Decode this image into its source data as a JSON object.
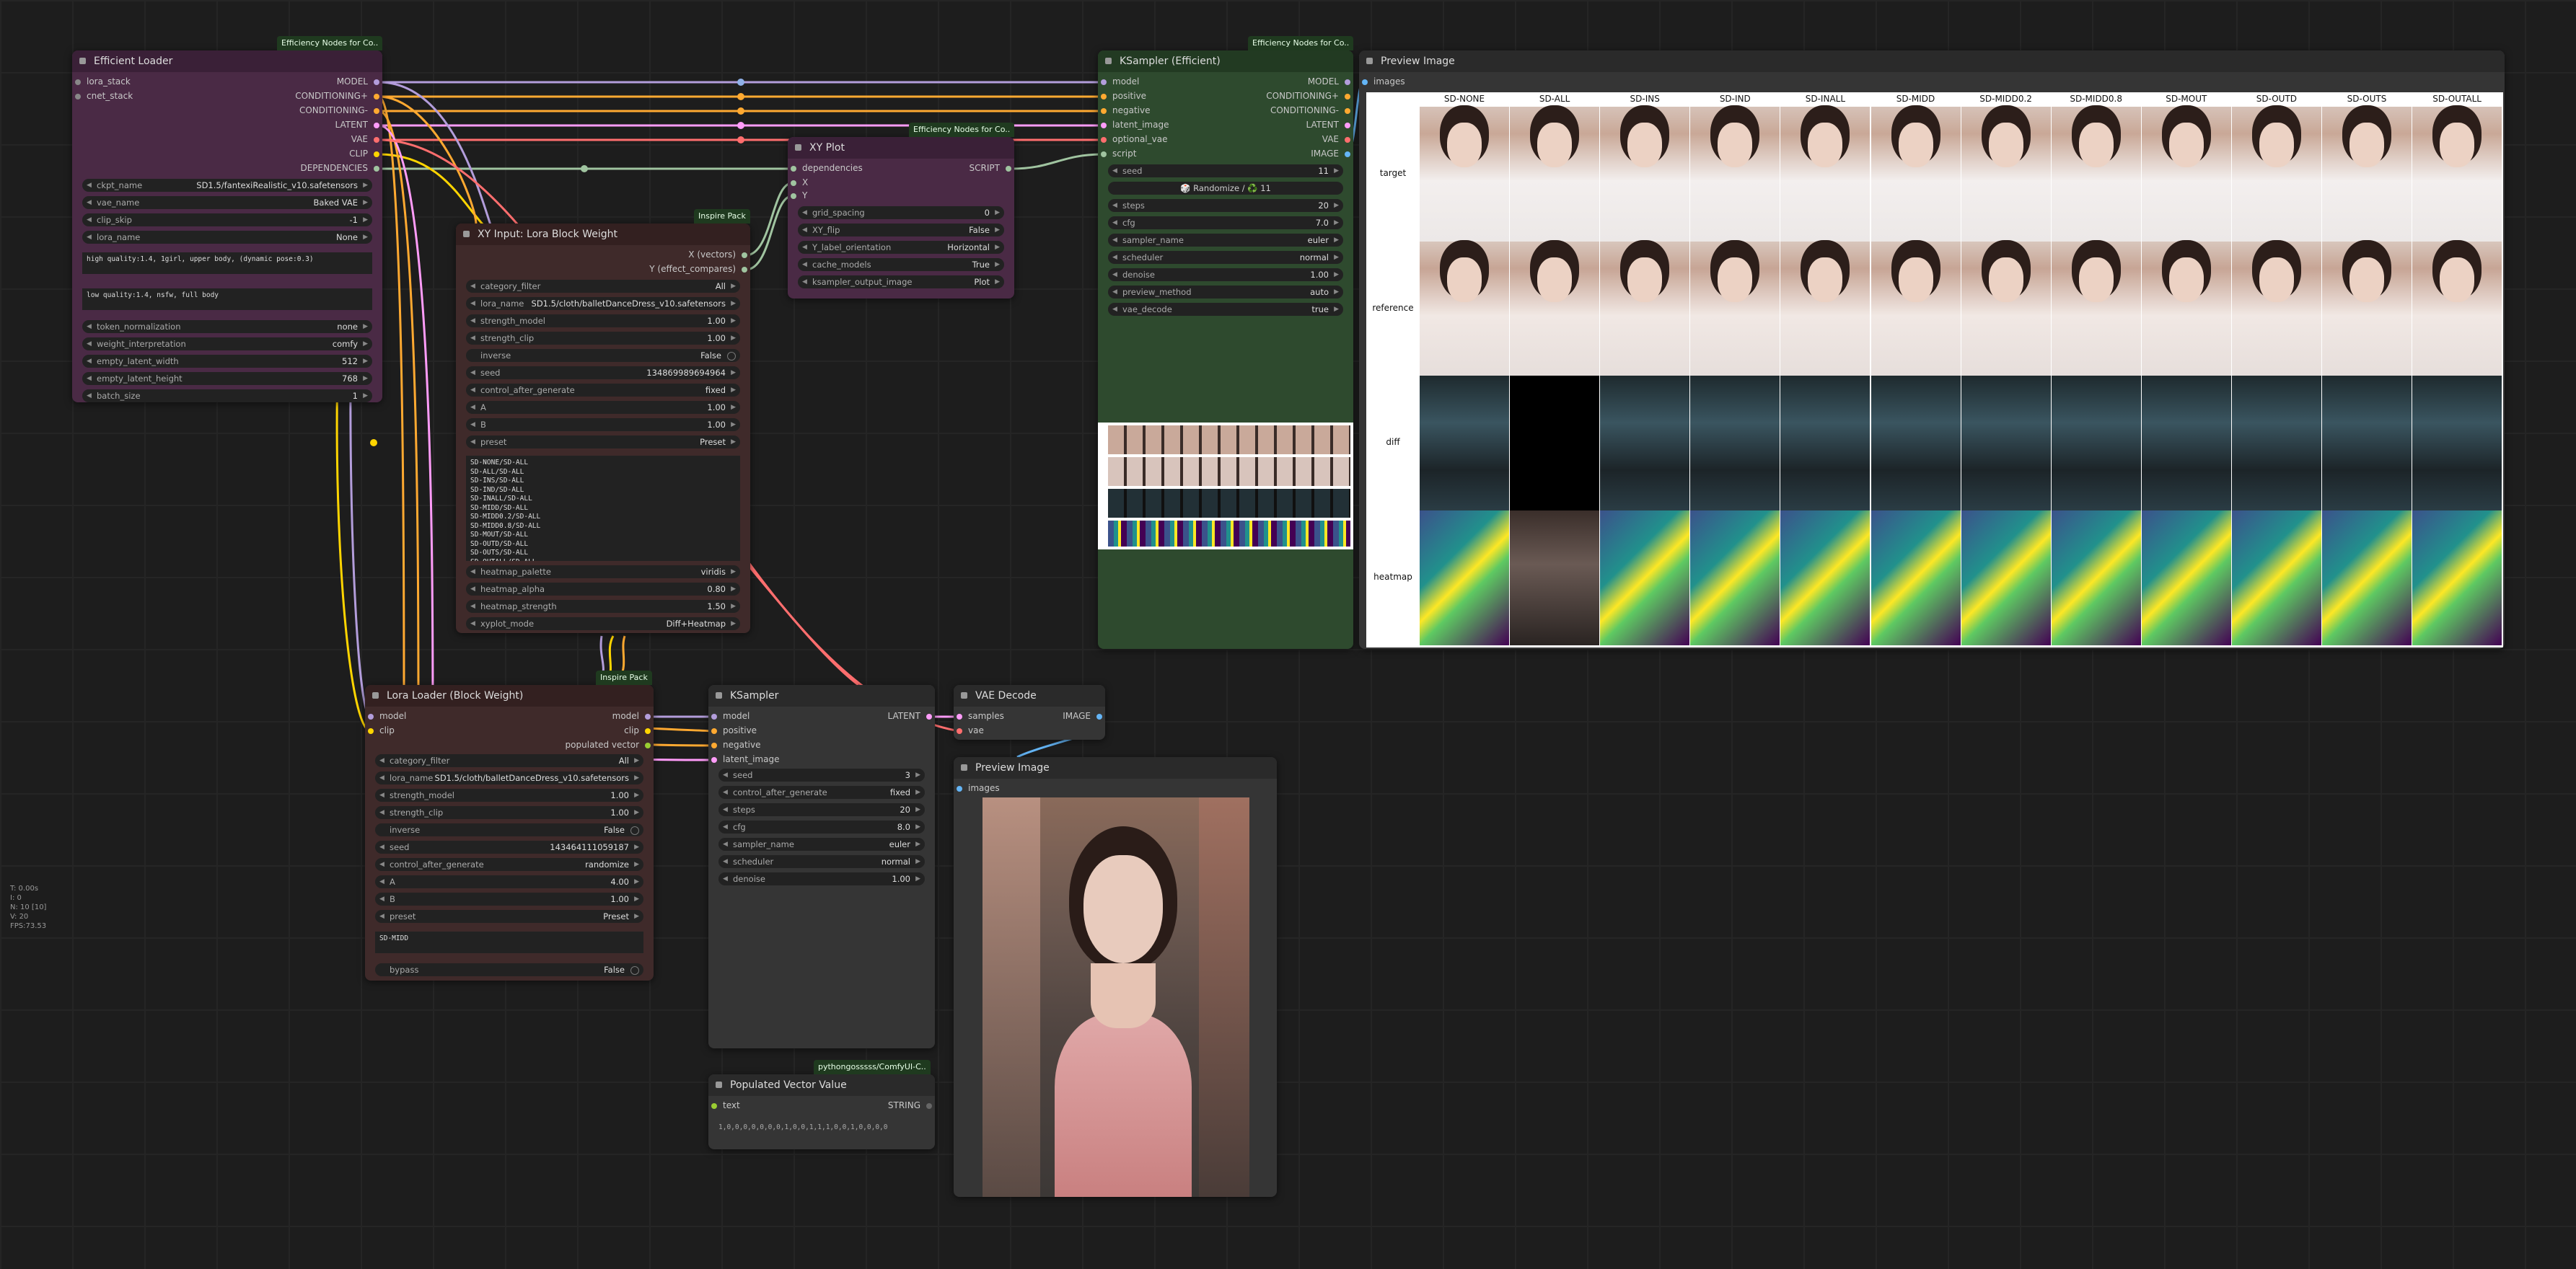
{
  "colors": {
    "model": "#b39ddb",
    "conditioning": "#ffa931",
    "latent": "#ff9cf9",
    "vae": "#ff6e6e",
    "clip": "#ffd500",
    "image": "#64b5f6",
    "script": "#a0c4a0"
  },
  "stats": "T: 0.00s\nI: 0\nN: 10 [10]\nV: 20\nFPS:73.53",
  "efficient_loader": {
    "badge": "Efficiency Nodes for Co..",
    "title": "Efficient Loader",
    "inputs": [
      "lora_stack",
      "cnet_stack"
    ],
    "outputs": [
      "MODEL",
      "CONDITIONING+",
      "CONDITIONING-",
      "LATENT",
      "VAE",
      "CLIP",
      "DEPENDENCIES"
    ],
    "widgets": [
      {
        "label": "ckpt_name",
        "value": "SD1.5/fantexiRealistic_v10.safetensors"
      },
      {
        "label": "vae_name",
        "value": "Baked VAE"
      },
      {
        "label": "clip_skip",
        "value": "-1"
      },
      {
        "label": "lora_name",
        "value": "None"
      }
    ],
    "positive": "high quality:1.4, 1girl, upper body, (dynamic pose:0.3)",
    "negative": "low quality:1.4, nsfw, full body",
    "widgets2": [
      {
        "label": "token_normalization",
        "value": "none"
      },
      {
        "label": "weight_interpretation",
        "value": "comfy"
      },
      {
        "label": "empty_latent_width",
        "value": "512"
      },
      {
        "label": "empty_latent_height",
        "value": "768"
      },
      {
        "label": "batch_size",
        "value": "1"
      }
    ]
  },
  "xy_plot": {
    "badge": "Efficiency Nodes for Co..",
    "title": "XY Plot",
    "inputs": [
      "dependencies",
      "X",
      "Y"
    ],
    "outputs": [
      "SCRIPT"
    ],
    "widgets": [
      {
        "label": "grid_spacing",
        "value": "0"
      },
      {
        "label": "XY_flip",
        "value": "False"
      },
      {
        "label": "Y_label_orientation",
        "value": "Horizontal"
      },
      {
        "label": "cache_models",
        "value": "True"
      },
      {
        "label": "ksampler_output_image",
        "value": "Plot"
      }
    ]
  },
  "xy_input": {
    "badge": "Inspire Pack",
    "title": "XY Input: Lora Block Weight",
    "outputs": [
      "X (vectors)",
      "Y (effect_compares)"
    ],
    "widgets": [
      {
        "label": "category_filter",
        "value": "All"
      },
      {
        "label": "lora_name",
        "value": "SD1.5/cloth/balletDanceDress_v10.safetensors"
      },
      {
        "label": "strength_model",
        "value": "1.00"
      },
      {
        "label": "strength_clip",
        "value": "1.00"
      },
      {
        "label": "inverse",
        "value": "False",
        "toggle": true
      },
      {
        "label": "seed",
        "value": "134869989694964"
      },
      {
        "label": "control_after_generate",
        "value": "fixed"
      },
      {
        "label": "A",
        "value": "1.00"
      },
      {
        "label": "B",
        "value": "1.00"
      },
      {
        "label": "preset",
        "value": "Preset"
      }
    ],
    "text": "SD-NONE/SD-ALL\nSD-ALL/SD-ALL\nSD-INS/SD-ALL\nSD-IND/SD-ALL\nSD-INALL/SD-ALL\nSD-MIDD/SD-ALL\nSD-MIDD0.2/SD-ALL\nSD-MIDD0.8/SD-ALL\nSD-MOUT/SD-ALL\nSD-OUTD/SD-ALL\nSD-OUTS/SD-ALL\nSD-OUTALL/SD-ALL",
    "widgets2": [
      {
        "label": "heatmap_palette",
        "value": "viridis"
      },
      {
        "label": "heatmap_alpha",
        "value": "0.80"
      },
      {
        "label": "heatmap_strength",
        "value": "1.50"
      },
      {
        "label": "xyplot_mode",
        "value": "Diff+Heatmap"
      }
    ]
  },
  "ksampler_eff": {
    "badge": "Efficiency Nodes for Co..",
    "title": "KSampler (Efficient)",
    "inputs": [
      "model",
      "positive",
      "negative",
      "latent_image",
      "optional_vae",
      "script"
    ],
    "outputs": [
      "MODEL",
      "CONDITIONING+",
      "CONDITIONING-",
      "LATENT",
      "VAE",
      "IMAGE"
    ],
    "seed": {
      "label": "seed",
      "value": "11"
    },
    "randomize": "🎲 Randomize / ♻️ 11",
    "widgets": [
      {
        "label": "steps",
        "value": "20"
      },
      {
        "label": "cfg",
        "value": "7.0"
      },
      {
        "label": "sampler_name",
        "value": "euler"
      },
      {
        "label": "scheduler",
        "value": "normal"
      },
      {
        "label": "denoise",
        "value": "1.00"
      },
      {
        "label": "preview_method",
        "value": "auto"
      },
      {
        "label": "vae_decode",
        "value": "true"
      }
    ]
  },
  "preview_big": {
    "title": "Preview Image",
    "input": "images",
    "columns": [
      "SD-NONE",
      "SD-ALL",
      "SD-INS",
      "SD-IND",
      "SD-INALL",
      "SD-MIDD",
      "SD-MIDD0.2",
      "SD-MIDD0.8",
      "SD-MOUT",
      "SD-OUTD",
      "SD-OUTS",
      "SD-OUTALL"
    ],
    "rows": [
      "target",
      "reference",
      "diff",
      "heatmap"
    ]
  },
  "lora_loader": {
    "badge": "Inspire Pack",
    "title": "Lora Loader (Block Weight)",
    "inputs": [
      "model",
      "clip"
    ],
    "outputs": [
      "model",
      "clip",
      "populated vector"
    ],
    "widgets": [
      {
        "label": "category_filter",
        "value": "All"
      },
      {
        "label": "lora_name",
        "value": "SD1.5/cloth/balletDanceDress_v10.safetensors"
      },
      {
        "label": "strength_model",
        "value": "1.00"
      },
      {
        "label": "strength_clip",
        "value": "1.00"
      },
      {
        "label": "inverse",
        "value": "False",
        "toggle": true
      },
      {
        "label": "seed",
        "value": "143464111059187"
      },
      {
        "label": "control_after_generate",
        "value": "randomize"
      },
      {
        "label": "A",
        "value": "4.00"
      },
      {
        "label": "B",
        "value": "1.00"
      },
      {
        "label": "preset",
        "value": "Preset"
      }
    ],
    "text": "SD-MIDD",
    "bypass": {
      "label": "bypass",
      "value": "False"
    }
  },
  "ksampler": {
    "title": "KSampler",
    "inputs": [
      "model",
      "positive",
      "negative",
      "latent_image"
    ],
    "outputs": [
      "LATENT"
    ],
    "widgets": [
      {
        "label": "seed",
        "value": "3"
      },
      {
        "label": "control_after_generate",
        "value": "fixed"
      },
      {
        "label": "steps",
        "value": "20"
      },
      {
        "label": "cfg",
        "value": "8.0"
      },
      {
        "label": "sampler_name",
        "value": "euler"
      },
      {
        "label": "scheduler",
        "value": "normal"
      },
      {
        "label": "denoise",
        "value": "1.00"
      }
    ]
  },
  "vae_decode": {
    "title": "VAE Decode",
    "inputs": [
      "samples",
      "vae"
    ],
    "outputs": [
      "IMAGE"
    ]
  },
  "preview_small": {
    "title": "Preview Image",
    "input": "images"
  },
  "populated": {
    "badge": "pythongosssss/ComfyUI-C..",
    "title": "Populated Vector Value",
    "inputs": [
      "text"
    ],
    "outputs": [
      "STRING"
    ],
    "value": "1,0,0,0,0,0,0,0,1,0,0,1,1,1,0,0,1,0,0,0,0"
  }
}
